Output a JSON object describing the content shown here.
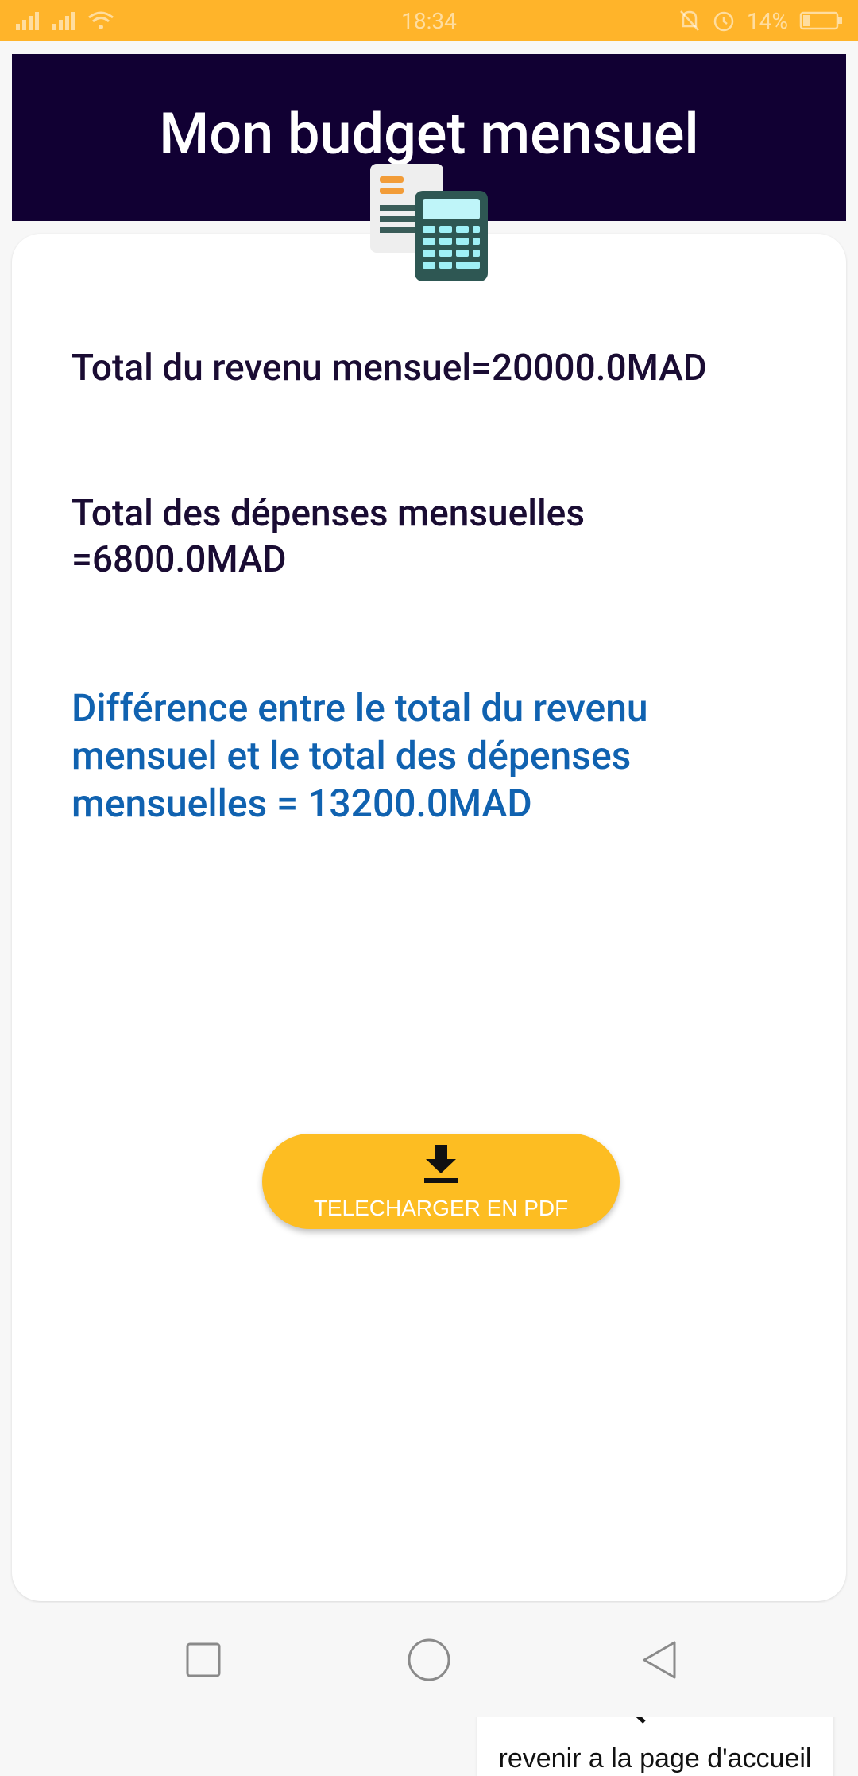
{
  "status_bar": {
    "time": "18:34",
    "battery": "14%",
    "icons": [
      "signal-icon",
      "signal-icon",
      "wifi-icon",
      "mute-icon",
      "alarm-icon",
      "battery-icon"
    ]
  },
  "header": {
    "title": "Mon budget mensuel",
    "icon": "calculator-icon"
  },
  "summary": {
    "income": "Total du revenu mensuel=20000.0MAD",
    "expenses_line1": "Total des dépenses mensuelles",
    "expenses_line2": "=6800.0MAD",
    "difference_line1": "Différence entre le total du revenu",
    "difference_line2": "mensuel et le total des dépenses",
    "difference_line3": "mensuelles = 13200.0MAD"
  },
  "actions": {
    "download_label": "TELECHARGER EN PDF",
    "download_icon": "download-icon",
    "home_label": "revenir a la page d'accueil",
    "home_icon": "return-arrow-icon"
  },
  "nav_bar": {
    "items": [
      "recent-apps-icon",
      "home-icon",
      "back-icon"
    ]
  },
  "colors": {
    "status_bar": "#ffb42a",
    "header_bg": "#110033",
    "text_dark": "#1a0c33",
    "text_blue": "#1062b0",
    "button_yellow": "#fdbd22"
  }
}
